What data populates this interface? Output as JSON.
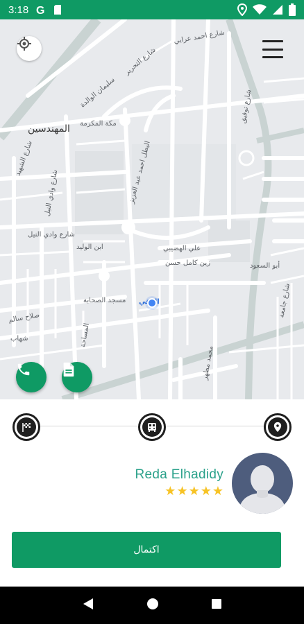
{
  "status_bar": {
    "time": "3:18",
    "background_color": "#0f9a64",
    "left_icons": [
      "google-icon",
      "sd-card-icon"
    ],
    "right_icons": [
      "location-icon",
      "wifi-icon",
      "signal-icon",
      "battery-icon"
    ]
  },
  "map": {
    "labels": {
      "muhandiseen": "المهندسين",
      "mukarma": "مكة المكرمة",
      "suliman": "سليمان الوالدة",
      "tahrir": "شارع التحرير",
      "ahmed": "شارع احمد عرابي",
      "khaled": "خالد بن الوليد",
      "omar": "شارع الشهيد",
      "kalfoun": "شارع وادي النيل",
      "nile": "شارع وادي النيل",
      "doukki": "الدقي",
      "batal": "البطل احمد عبد العزيز",
      "musaddiq": "مصدق",
      "fouad": "مسجد الصحابة",
      "hussein": "علي الهضيبي",
      "zein": "زين كامل حسن",
      "mesaha": "شارع مصدق",
      "sawra": "التحرير",
      "abu": "أبو السعود",
      "gamal": "شارع جامعة",
      "salah": "صلاح سالم",
      "shehab": "شهاب",
      "ebn": "ابن الوليد",
      "modia": "المساحة",
      "nabatat": "محمد مظهر",
      "ramlah": "شارع مصدق",
      "tawfik": "شارع توفيق"
    },
    "current_location_label": "الدقي"
  },
  "panel": {
    "driver_name": "Reda Elhadidy",
    "rating_stars": 5,
    "complete_button_label": "اكتمال",
    "accent_color": "#0f9a64",
    "name_color": "#2aa18a",
    "star_color": "#f7c325"
  }
}
